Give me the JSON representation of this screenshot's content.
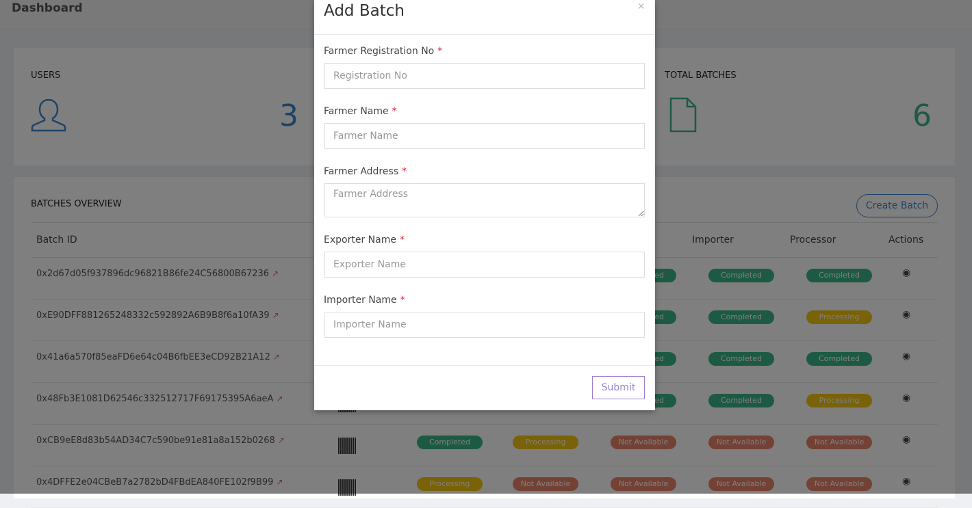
{
  "header": {
    "title": "Dashboard"
  },
  "stats": [
    {
      "label": "USERS",
      "value": "3",
      "icon": "user-icon",
      "color": "#3f86cf"
    },
    {
      "label": "TOTAL BATCHES",
      "value": "6",
      "icon": "file-icon",
      "color": "#3ab586"
    }
  ],
  "overview": {
    "title": "BATCHES OVERVIEW",
    "create_label": "Create Batch",
    "headers": {
      "batch_id": "Batch ID",
      "importer": "Importer",
      "processor": "Processor",
      "actions": "Actions"
    },
    "rows": [
      {
        "id": "0x2d67d05f937896dc96821B86fe24C56800B67236",
        "c3": "",
        "c4": "",
        "c5": "Completed",
        "importer": "Completed",
        "processor": "Completed"
      },
      {
        "id": "0xE90DFF881265248332c592892A6B9B8f6a10fA39",
        "c3": "",
        "c4": "",
        "c5": "Completed",
        "importer": "Completed",
        "processor": "Processing"
      },
      {
        "id": "0x41a6a570f85eaFD6e64c04B6fbEE3eCD92B21A12",
        "c3": "",
        "c4": "",
        "c5": "Completed",
        "importer": "Completed",
        "processor": "Completed"
      },
      {
        "id": "0x48Fb3E1081D62546c332512717F69175395A6aeA",
        "c3": "",
        "c4": "",
        "c5": "Completed",
        "importer": "Completed",
        "processor": "Processing"
      },
      {
        "id": "0xCB9eE8d83b54AD34C7c590be91e81a8a152b0268",
        "c3": "Completed",
        "c4": "Processing",
        "c5": "Not Available",
        "importer": "Not Available",
        "processor": "Not Available"
      },
      {
        "id": "0x4DFFE2e04CBeB7a2782bD4FBdEA840FE102f9B99",
        "c3": "Processing",
        "c4": "Not Available",
        "c5": "Not Available",
        "importer": "Not Available",
        "processor": "Not Available"
      }
    ]
  },
  "status_colors": {
    "Completed": "#3ab586",
    "Processing": "#f2c40f",
    "Not Available": "#e8836b"
  },
  "modal": {
    "title": "Add Batch",
    "close": "×",
    "submit": "Submit",
    "fields": [
      {
        "label": "Farmer Registration No",
        "required": "*",
        "placeholder": "Registration No",
        "value": ""
      },
      {
        "label": "Farmer Name",
        "required": "*",
        "placeholder": "Farmer Name",
        "value": ""
      },
      {
        "label": "Farmer Address",
        "required": "*",
        "placeholder": "Farmer Address",
        "value": ""
      },
      {
        "label": "Exporter Name",
        "required": "*",
        "placeholder": "Exporter Name",
        "value": ""
      },
      {
        "label": "Importer Name",
        "required": "*",
        "placeholder": "Importer Name",
        "value": ""
      }
    ]
  }
}
